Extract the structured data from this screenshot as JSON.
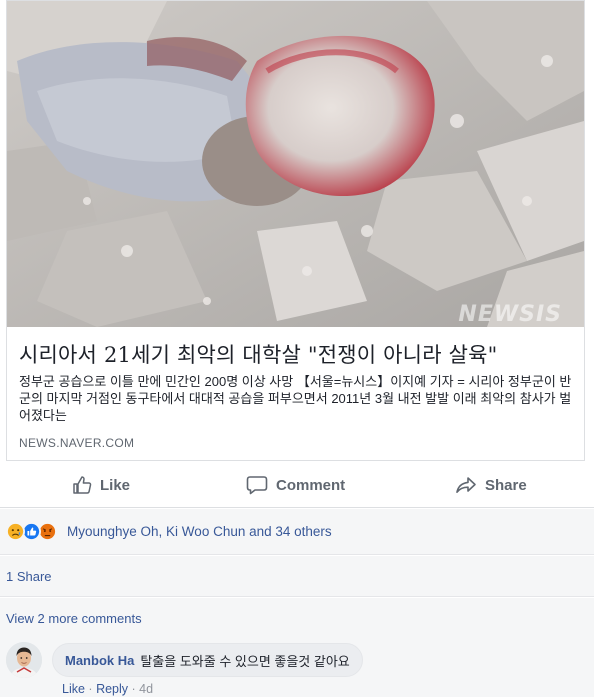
{
  "link_card": {
    "headline": "시리아서 21세기 최악의 대학살 \"전쟁이 아니라 살육\"",
    "description": "정부군 공습으로 이틀 만에 민간인 200명 이상 사망 【서울=뉴시스】이지예 기자 = 시리아 정부군이 반군의 마지막 거점인 동구타에서 대대적 공습을 퍼부으면서 2011년 3월 내전 발발 이래 최악의 참사가 벌어졌다는",
    "domain": "NEWS.NAVER.COM",
    "watermark": "NEWSIS"
  },
  "actions": {
    "like_label": "Like",
    "comment_label": "Comment",
    "share_label": "Share"
  },
  "reactions": {
    "icons": [
      "sad-icon",
      "like-icon",
      "angry-icon"
    ],
    "summary": "Myounghye Oh, Ki Woo Chun and 34 others"
  },
  "shares": {
    "label": "1 Share"
  },
  "comments": {
    "view_more": "View 2 more comments",
    "items": [
      {
        "author": "Manbok Ha",
        "text": "탈출을 도와줄 수 있으면 좋을것 같아요",
        "like_label": "Like",
        "reply_label": "Reply",
        "time": "4d"
      }
    ]
  },
  "colors": {
    "link_blue": "#385898",
    "text_dark": "#1d2129",
    "text_gray": "#606770",
    "feed_bg": "#f5f6f7",
    "like_blue": "#1877f2",
    "reaction_yellow": "#f7b125",
    "angry_orange": "#e9710f"
  }
}
